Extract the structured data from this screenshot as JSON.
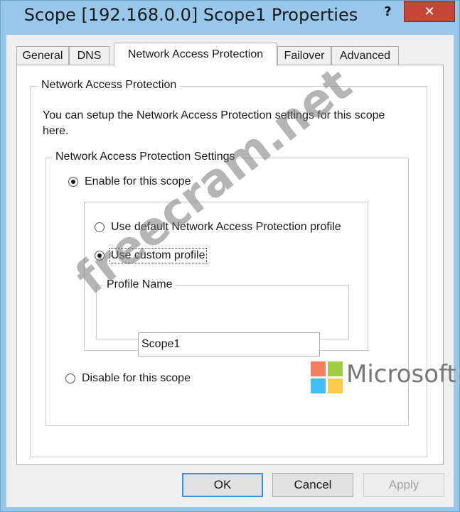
{
  "window": {
    "title": "Scope [192.168.0.0] Scope1 Properties",
    "help_label": "?",
    "close_label": "✕"
  },
  "tabs": [
    {
      "label": "General",
      "active": false
    },
    {
      "label": "DNS",
      "active": false
    },
    {
      "label": "Network Access Protection",
      "active": true
    },
    {
      "label": "Failover",
      "active": false
    },
    {
      "label": "Advanced",
      "active": false
    }
  ],
  "nap_group": {
    "legend": "Network Access Protection",
    "description": "You can setup the Network Access Protection settings for this scope here."
  },
  "settings_group": {
    "legend": "Network Access Protection Settings",
    "enable_label": "Enable for this scope",
    "enable_checked": true,
    "use_default_label": "Use default Network Access Protection profile",
    "use_default_checked": false,
    "use_custom_label": "Use custom profile",
    "use_custom_checked": true,
    "disable_label": "Disable for this scope",
    "disable_checked": false
  },
  "profile_group": {
    "legend": "Profile Name",
    "value": "Scope1"
  },
  "buttons": {
    "ok": "OK",
    "cancel": "Cancel",
    "apply": "Apply",
    "apply_disabled": true
  },
  "overlays": {
    "watermark": "freecram.net",
    "brand_text": "Microsoft",
    "brand_colors": [
      "#f35325",
      "#81bc06",
      "#05a6f0",
      "#ffba08"
    ]
  }
}
